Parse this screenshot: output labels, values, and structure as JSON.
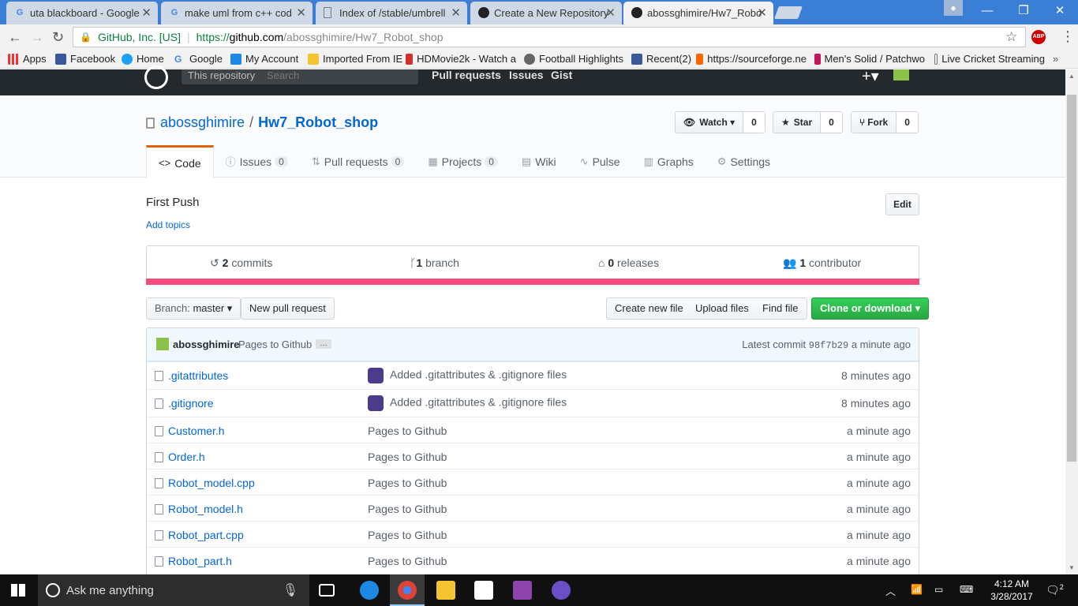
{
  "browser": {
    "tabs": [
      {
        "title": "uta blackboard - Google",
        "icon": "google-icon"
      },
      {
        "title": "make uml from c++ cod",
        "icon": "google-icon"
      },
      {
        "title": "Index of /stable/umbrell",
        "icon": "page-icon"
      },
      {
        "title": "Create a New Repository",
        "icon": "github-icon"
      },
      {
        "title": "abossghimire/Hw7_Robo",
        "icon": "github-icon"
      }
    ],
    "secure_label": "GitHub, Inc. [US]",
    "url_prefix": "https://",
    "url_host": "github.com",
    "url_path": "/abossghimire/Hw7_Robot_shop",
    "abp_label": "ABP",
    "bookmarks": [
      {
        "label": "Apps",
        "icon": "apps-icon"
      },
      {
        "label": "Facebook",
        "icon": "facebook-icon"
      },
      {
        "label": "Home",
        "icon": "twitter-icon"
      },
      {
        "label": "Google",
        "icon": "google-icon"
      },
      {
        "label": "My Account",
        "icon": "windows-icon"
      },
      {
        "label": "Imported From IE",
        "icon": "folder-icon"
      },
      {
        "label": "HDMovie2k - Watch a",
        "icon": "hd-icon"
      },
      {
        "label": "Football Highlights",
        "icon": "football-icon"
      },
      {
        "label": "Recent(2)",
        "icon": "facebook-icon"
      },
      {
        "label": "https://sourceforge.ne",
        "icon": "sourceforge-icon"
      },
      {
        "label": "Men's Solid / Patchwo",
        "icon": "in-icon"
      },
      {
        "label": "Live Cricket Streaming",
        "icon": "page-icon"
      }
    ]
  },
  "github": {
    "scope_label": "This repository",
    "search_placeholder": "Search",
    "nav": [
      "Pull requests",
      "Issues",
      "Gist"
    ],
    "owner": "abossghimire",
    "repo": "Hw7_Robot_shop",
    "watch_label": "Watch",
    "watch_count": "0",
    "star_label": "Star",
    "star_count": "0",
    "fork_label": "Fork",
    "fork_count": "0",
    "tabs": [
      {
        "label": "Code",
        "count": null
      },
      {
        "label": "Issues",
        "count": "0"
      },
      {
        "label": "Pull requests",
        "count": "0"
      },
      {
        "label": "Projects",
        "count": "0"
      },
      {
        "label": "Wiki",
        "count": null
      },
      {
        "label": "Pulse",
        "count": null
      },
      {
        "label": "Graphs",
        "count": null
      },
      {
        "label": "Settings",
        "count": null
      }
    ],
    "description": "First Push",
    "add_topics": "Add topics",
    "edit_label": "Edit",
    "summary": {
      "commits_num": "2",
      "commits_label": "commits",
      "branch_num": "1",
      "branch_label": "branch",
      "releases_num": "0",
      "releases_label": "releases",
      "contributors_num": "1",
      "contributors_label": "contributor"
    },
    "language_color": "#f34b7d",
    "branch_prefix": "Branch:",
    "branch_name": "master",
    "new_pr": "New pull request",
    "create_file": "Create new file",
    "upload_files": "Upload files",
    "find_file": "Find file",
    "clone": "Clone or download",
    "commit": {
      "author": "abossghimire",
      "message": "Pages to Github",
      "ellipsis": "…",
      "latest_label": "Latest commit",
      "sha": "98f7b29",
      "age": "a minute ago"
    },
    "files": [
      {
        "name": ".gitattributes",
        "message": "Added .gitattributes & .gitignore files",
        "age": "8 minutes ago",
        "avatar": true
      },
      {
        "name": ".gitignore",
        "message": "Added .gitattributes & .gitignore files",
        "age": "8 minutes ago",
        "avatar": true
      },
      {
        "name": "Customer.h",
        "message": "Pages to Github",
        "age": "a minute ago",
        "avatar": false
      },
      {
        "name": "Order.h",
        "message": "Pages to Github",
        "age": "a minute ago",
        "avatar": false
      },
      {
        "name": "Robot_model.cpp",
        "message": "Pages to Github",
        "age": "a minute ago",
        "avatar": false
      },
      {
        "name": "Robot_model.h",
        "message": "Pages to Github",
        "age": "a minute ago",
        "avatar": false
      },
      {
        "name": "Robot_part.cpp",
        "message": "Pages to Github",
        "age": "a minute ago",
        "avatar": false
      },
      {
        "name": "Robot_part.h",
        "message": "Pages to Github",
        "age": "a minute ago",
        "avatar": false
      }
    ]
  },
  "taskbar": {
    "search_placeholder": "Ask me anything",
    "time": "4:12 AM",
    "date": "3/28/2017",
    "notifications": "2"
  }
}
